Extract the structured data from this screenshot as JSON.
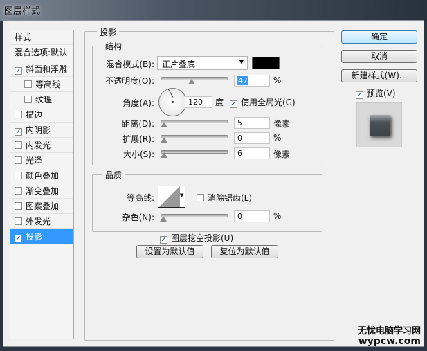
{
  "window": {
    "title": "图层样式"
  },
  "sidebar": {
    "header": "样式",
    "blend_options": "混合选项:默认",
    "items": [
      {
        "label": "斜面和浮雕",
        "checked": true,
        "sub": false
      },
      {
        "label": "等高线",
        "checked": false,
        "sub": true
      },
      {
        "label": "纹理",
        "checked": false,
        "sub": true
      },
      {
        "label": "描边",
        "checked": false,
        "sub": false
      },
      {
        "label": "内阴影",
        "checked": true,
        "sub": false
      },
      {
        "label": "内发光",
        "checked": false,
        "sub": false
      },
      {
        "label": "光泽",
        "checked": false,
        "sub": false
      },
      {
        "label": "颜色叠加",
        "checked": false,
        "sub": false
      },
      {
        "label": "渐变叠加",
        "checked": false,
        "sub": false
      },
      {
        "label": "图案叠加",
        "checked": false,
        "sub": false
      },
      {
        "label": "外发光",
        "checked": false,
        "sub": false
      },
      {
        "label": "投影",
        "checked": true,
        "sub": false,
        "selected": true
      }
    ]
  },
  "main": {
    "title": "投影",
    "structure": {
      "title": "结构",
      "blend_mode_label": "混合模式(B):",
      "blend_mode": "正片叠底",
      "shadow_color": "#000000",
      "opacity_label": "不透明度(O):",
      "opacity": "47",
      "opacity_unit": "%",
      "angle_label": "角度(A):",
      "angle": "120",
      "angle_unit": "度",
      "global_light_label": "使用全局光(G)",
      "global_light": true,
      "distance_label": "距离(D):",
      "distance": "5",
      "distance_unit": "像素",
      "spread_label": "扩展(R):",
      "spread": "0",
      "spread_unit": "%",
      "size_label": "大小(S):",
      "size": "6",
      "size_unit": "像素"
    },
    "quality": {
      "title": "品质",
      "contour_label": "等高线:",
      "antialias_label": "消除锯齿(L)",
      "antialias": false,
      "noise_label": "杂色(N):",
      "noise": "0",
      "noise_unit": "%"
    },
    "knockout_label": "图层挖空投影(U)",
    "knockout": true,
    "make_default": "设置为默认值",
    "reset_default": "复位为默认值"
  },
  "buttons": {
    "ok": "确定",
    "cancel": "取消",
    "new_style": "新建样式(W)...",
    "preview_label": "预览(V)",
    "preview": true
  },
  "watermark": {
    "line1": "无忧电脑学习网",
    "line2": "wypcw.com"
  }
}
